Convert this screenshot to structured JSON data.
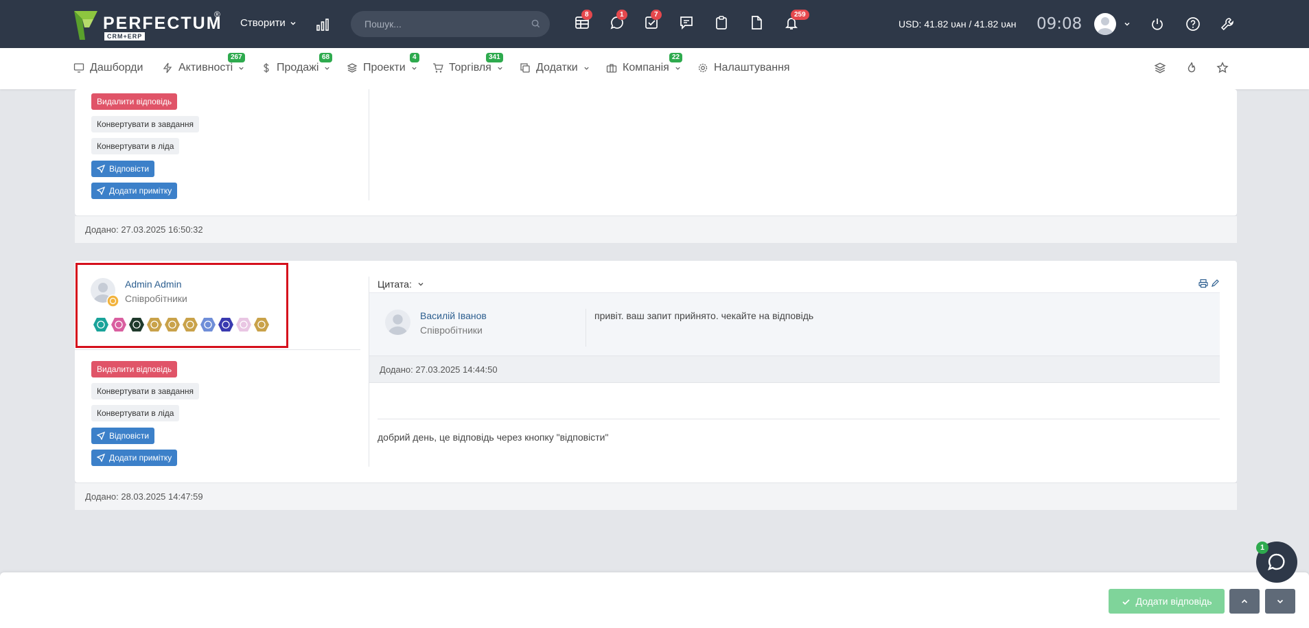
{
  "topbar": {
    "logo_text": "PERFECTUM",
    "logo_reg": "®",
    "logo_sub": "CRM+ERP",
    "create_label": "Створити",
    "search_placeholder": "Пошук...",
    "badges": {
      "grid": "8",
      "chat": "1",
      "tasks": "7",
      "bell": "259"
    },
    "currency": "USD: 41.82 ᴜᴀʜ / 41.82 ᴜᴀʜ",
    "time": "09:08"
  },
  "menu": {
    "items": [
      {
        "label": "Дашборди",
        "icon": "monitor-icon"
      },
      {
        "label": "Активності",
        "icon": "bolt-icon",
        "badge": "267"
      },
      {
        "label": "Продажі",
        "icon": "dollar-icon",
        "badge": "68"
      },
      {
        "label": "Проекти",
        "icon": "layers-icon",
        "badge": "4"
      },
      {
        "label": "Торгівля",
        "icon": "cart-icon",
        "badge": "341"
      },
      {
        "label": "Додатки",
        "icon": "copy-icon"
      },
      {
        "label": "Компанія",
        "icon": "briefcase-icon",
        "badge": "22"
      },
      {
        "label": "Налаштування",
        "icon": "gear-icon"
      }
    ]
  },
  "reply1": {
    "actions": {
      "delete": "Видалити відповідь",
      "to_task": "Конвертувати в завдання",
      "to_lead": "Конвертувати в ліда",
      "reply": "Відповісти",
      "add_note": "Додати примітку"
    },
    "added": "Додано: 27.03.2025 16:50:32"
  },
  "reply2": {
    "author": "Admin Admin",
    "role": "Співробітники",
    "achievement_colors": [
      "#1aa39a",
      "#d95fa0",
      "#1f3a2c",
      "#c9a24a",
      "#c9a24a",
      "#c9a24a",
      "#6f8ed8",
      "#3a3ab0",
      "#e9c6e3",
      "#c9a24a"
    ],
    "actions": {
      "delete": "Видалити відповідь",
      "to_task": "Конвертувати в завдання",
      "to_lead": "Конвертувати в ліда",
      "reply": "Відповісти",
      "add_note": "Додати примітку"
    },
    "quote_label": "Цитата:",
    "quote": {
      "author": "Василій Іванов",
      "role": "Співробітники",
      "text": "привіт. ваш запит прийнято. чекайте на відповідь",
      "added": "Додано: 27.03.2025 14:44:50"
    },
    "text": "добрий день, це відповідь через кнопку \"відповісти\"",
    "added": "Додано: 28.03.2025 14:47:59"
  },
  "bottom": {
    "add_reply": "Додати відповідь",
    "chat_badge": "1"
  }
}
